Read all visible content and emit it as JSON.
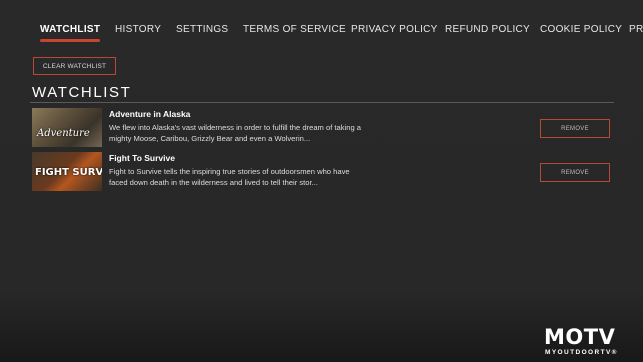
{
  "nav": {
    "items": [
      {
        "label": "WATCHLIST",
        "active": true
      },
      {
        "label": "HISTORY",
        "active": false
      },
      {
        "label": "SETTINGS",
        "active": false
      },
      {
        "label": "TERMS OF SERVICE",
        "active": false
      },
      {
        "label": "PRIVACY POLICY",
        "active": false
      },
      {
        "label": "REFUND POLICY",
        "active": false
      },
      {
        "label": "COOKIE POLICY",
        "active": false
      },
      {
        "label": "PRO",
        "active": false
      }
    ],
    "accent": "#c9432f"
  },
  "clear_button": "CLEAR WATCHLIST",
  "section_title": "WATCHLIST",
  "watchlist": [
    {
      "title": "Adventure in Alaska",
      "description": "We flew into Alaska's vast wilderness in order to fulfill the dream of taking a mighty Moose, Caribou, Grizzly Bear and even a Wolverin...",
      "thumb_text": "Adventure",
      "remove_label": "REMOVE"
    },
    {
      "title": "Fight To Survive",
      "description": "Fight to Survive tells the inspiring true stories of outdoorsmen who have faced down death in the wilderness and lived to tell their stor...",
      "thumb_text": "FIGHT SURVIVE",
      "remove_label": "REMOVE"
    }
  ],
  "logo": {
    "main": "MOTV",
    "sub": "MYOUTDOORTV®"
  }
}
